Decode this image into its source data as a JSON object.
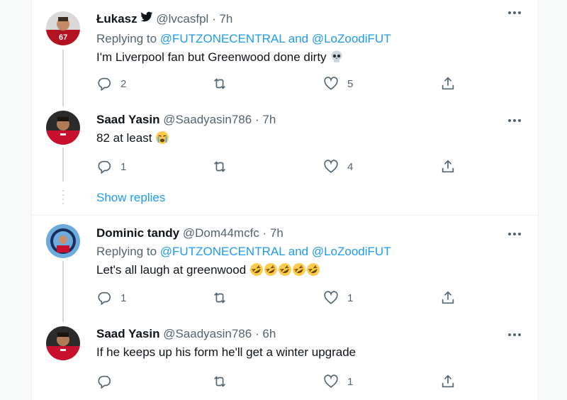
{
  "tweets": [
    {
      "name": "Łukasz",
      "verified": true,
      "handle": "@lvcasfpl",
      "time": "7h",
      "replying_prefix": "Replying to ",
      "mention1": "@FUTZONECENTRAL",
      "and_text": " and ",
      "mention2": "@LoZoodiFUT",
      "text": "I'm Liverpool fan but Greenwood done dirty",
      "emoji": "skull",
      "replies": "2",
      "retweets": "",
      "likes": "5"
    },
    {
      "name": "Saad Yasin",
      "handle": "@Saadyasin786",
      "time": "7h",
      "text": "82 at least",
      "emoji": "crying-face",
      "replies": "1",
      "retweets": "",
      "likes": "4"
    },
    {
      "name": "Dominic tandy",
      "handle": "@Dom44mcfc",
      "time": "7h",
      "replying_prefix": "Replying to ",
      "mention1": "@FUTZONECENTRAL",
      "and_text": " and ",
      "mention2": "@LoZoodiFUT",
      "text": "Let's all laugh at greenwood",
      "emoji": "rolling-on-floor-laughing x5",
      "replies": "1",
      "retweets": "",
      "likes": "1"
    },
    {
      "name": "Saad Yasin",
      "handle": "@Saadyasin786",
      "time": "6h",
      "text": "If he keeps up his form he'll get a winter upgrade",
      "replies": "",
      "retweets": "",
      "likes": "1"
    }
  ],
  "show_replies": "Show replies",
  "separator": "·",
  "colors": {
    "accent": "#1d9bf0",
    "muted": "#536471",
    "text": "#0f1419",
    "border": "#eff3f4"
  }
}
